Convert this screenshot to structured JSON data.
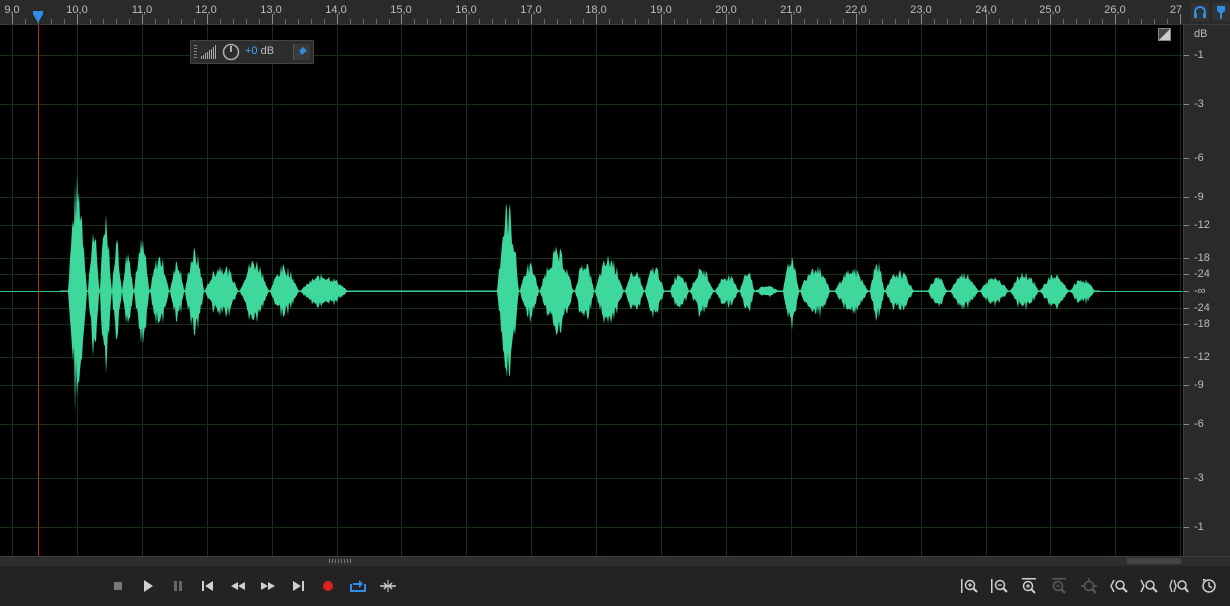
{
  "ruler": {
    "labels": [
      "9,0",
      "10,0",
      "11,0",
      "12,0",
      "13,0",
      "14,0",
      "15,0",
      "16,0",
      "17,0",
      "18,0",
      "19,0",
      "20,0",
      "21,0",
      "22,0",
      "23,0",
      "24,0",
      "25,0",
      "26,0",
      "27"
    ]
  },
  "db_scale": {
    "unit": "dB",
    "labels": [
      "-1",
      "-3",
      "-6",
      "-9",
      "-12",
      "-18",
      "-24",
      "-∞",
      "-24",
      "-18",
      "-12",
      "-9",
      "-6",
      "-3",
      "-1"
    ]
  },
  "hud": {
    "volume_value": "+0",
    "volume_unit": "dB"
  },
  "colors": {
    "waveform": "#3ed89c",
    "playhead": "#c2262a",
    "grid": "#173017",
    "accent": "#2f8ee8",
    "record": "#e02020"
  },
  "transport": {
    "buttons": [
      "stop-icon",
      "play-icon",
      "pause-icon",
      "go-to-start-icon",
      "rewind-icon",
      "fast-forward-icon",
      "go-to-end-icon",
      "record-icon",
      "loop-icon",
      "skip-selection-icon"
    ]
  },
  "zoom_tools": {
    "buttons": [
      "zoom-in-amplitude-icon",
      "zoom-out-amplitude-icon",
      "zoom-in-time-icon",
      "zoom-out-time-icon",
      "zoom-full-icon",
      "zoom-in-at-start-icon",
      "zoom-in-at-end-icon",
      "zoom-out-full-icon",
      "zoom-selection-icon"
    ]
  }
}
